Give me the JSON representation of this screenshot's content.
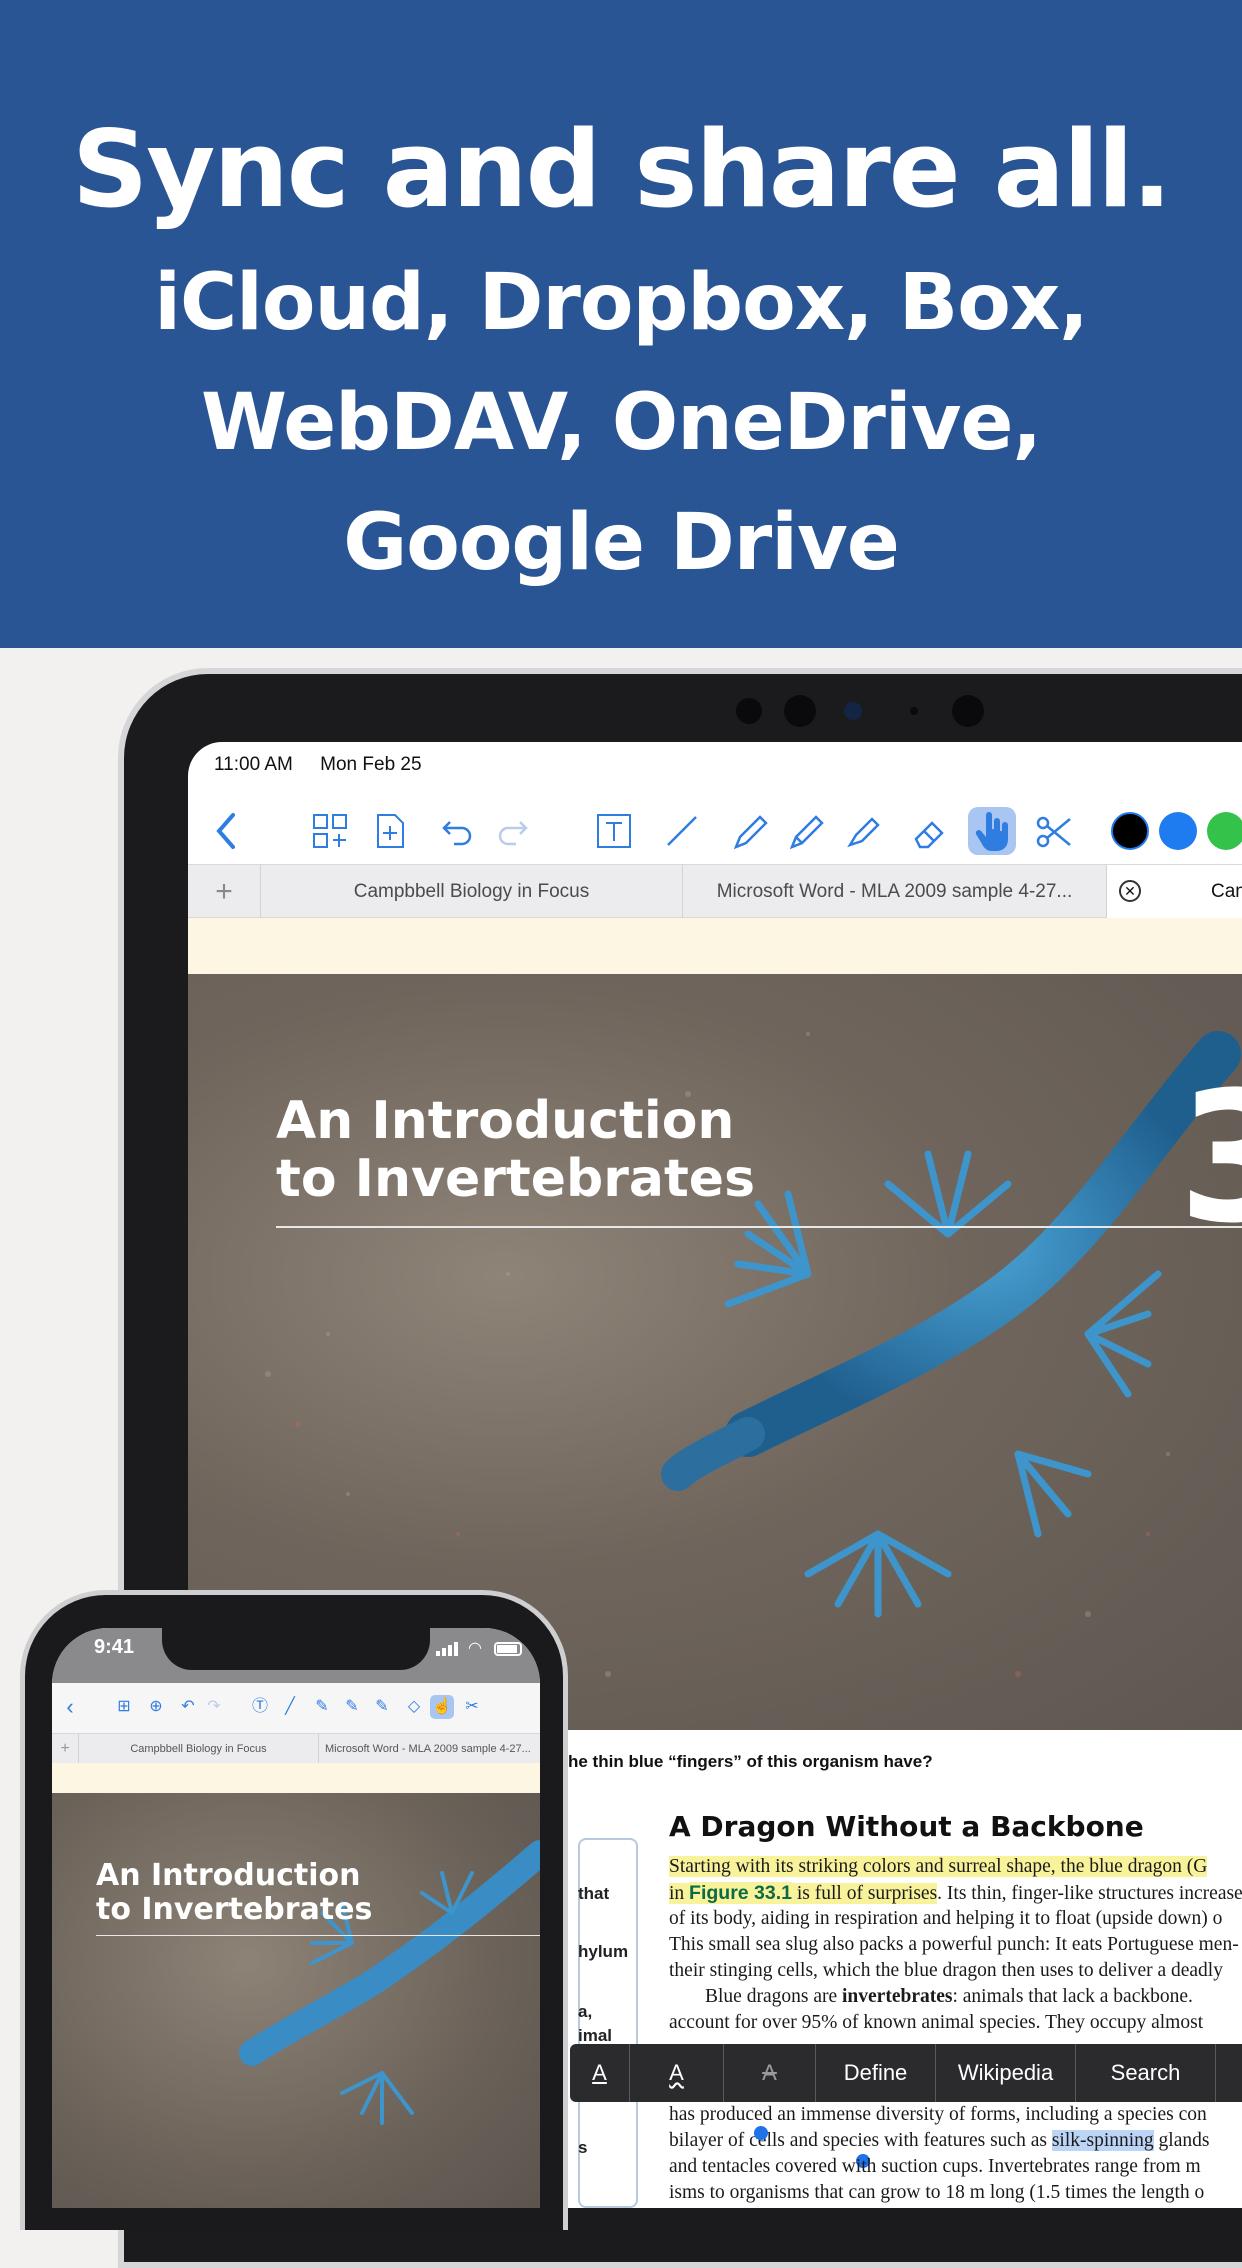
{
  "banner": {
    "headline": "Sync and share all.",
    "line1": "iCloud, Dropbox, Box,",
    "line2": "WebDAV, OneDrive,",
    "line3": "Google Drive",
    "bg_color": "#2a5595"
  },
  "ipad": {
    "status": {
      "time": "11:00 AM",
      "date": "Mon Feb 25"
    },
    "toolbar": {
      "icons": [
        "back-chevron-icon",
        "thumbnails-add-icon",
        "add-page-icon",
        "undo-icon",
        "redo-icon",
        "text-box-icon",
        "line-icon",
        "pen-icon",
        "pencil-icon",
        "highlighter-icon",
        "eraser-icon",
        "hand-pointer-icon",
        "scissors-icon"
      ],
      "colors": [
        "#000000",
        "#1e7cf0",
        "#35c24a"
      ]
    },
    "tabs": {
      "add_label": "+",
      "items": [
        "Campbbell Biology in Focus",
        "Microsoft Word - MLA 2009 sample 4-27...",
        "Cam"
      ]
    },
    "page": {
      "chapter_title_1": "An Introduction",
      "chapter_title_2": "to Invertebrates",
      "chapter_number": "3",
      "question": "he thin blue “fingers” of this organism have?",
      "section_title": "A Dragon Without a Backbone",
      "sidebar_lines": [
        "that",
        "hylum",
        "a,",
        "imal",
        "s"
      ],
      "lines": [
        "Starting with its striking colors and surreal shape, the blue dragon (G",
        "in",
        "Figure 33.1",
        "is full of surprises",
        ". Its thin, finger-like structures increase",
        "of its body, aiding in respiration and helping it to float (upside down) o",
        "This small sea slug also packs a powerful punch: It eats Portuguese men-",
        "their stinging cells, which the blue dragon then uses to deliver a deadly",
        "Blue dragons are",
        "invertebrates",
        ": animals that lack a backbone.",
        "account for over 95% of known animal species. They occupy almost",
        "has produced an immense diversity of forms, including a species con",
        "bilayer of cells and species with features such as",
        "silk-spinning",
        "glands",
        "and tentacles covered with suction cups. Invertebrates range from m",
        "isms to organisms that can grow to 18 m long (1.5 times the length o"
      ]
    },
    "context_menu": {
      "items": [
        "A",
        "A",
        "A",
        "Define",
        "Wikipedia",
        "Search"
      ]
    }
  },
  "iphone": {
    "status": {
      "time": "9:41"
    },
    "tabs": {
      "add_label": "+",
      "items": [
        "Campbbell Biology in Focus",
        "Microsoft Word - MLA 2009 sample 4-27..."
      ]
    },
    "page": {
      "chapter_title_1": "An Introduction",
      "chapter_title_2": "to Invertebrates"
    }
  }
}
